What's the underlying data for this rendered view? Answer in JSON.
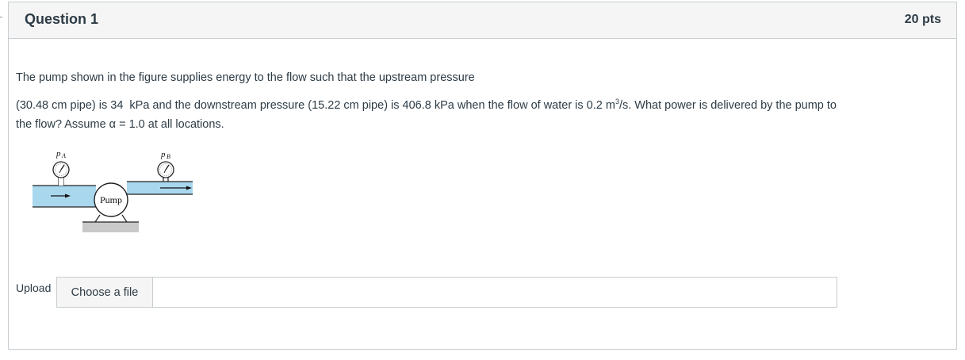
{
  "question": {
    "title": "Question 1",
    "points": "20 pts"
  },
  "body": {
    "line1": "The pump shown in the figure supplies energy to the flow such that the upstream pressure",
    "line2_a": "(30.48 cm pipe) is 34",
    "line2_b": "kPa and the downstream pressure (15.22 cm pipe) is 406.8 kPa when the flow of water is 0.2 m",
    "line2_sup": "3",
    "line2_c": "/s. What power is delivered by the pump to",
    "line3": "the flow? Assume α = 1.0 at all locations."
  },
  "figure": {
    "gauge_a_label": "p",
    "gauge_a_sub": "A",
    "gauge_b_label": "p",
    "gauge_b_sub": "B",
    "pump_label": "Pump",
    "pipe_color": "#a9d8ee",
    "base_color": "#c9c9c9"
  },
  "upload": {
    "label": "Upload",
    "button_label": "Choose a file"
  }
}
